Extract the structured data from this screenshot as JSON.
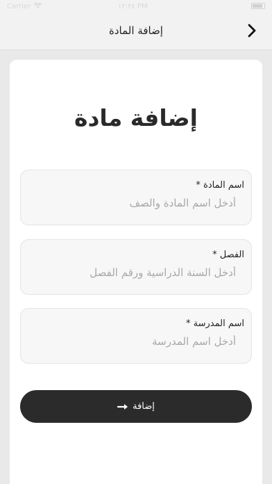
{
  "status_bar": {
    "carrier": "Carrier",
    "time": "١٢:٣٤ PM"
  },
  "nav": {
    "title": "إضافة المادة"
  },
  "form": {
    "heading": "إضافة مادة",
    "fields": [
      {
        "label": "اسم المادة *",
        "placeholder": "أدخل اسم المادة والصف"
      },
      {
        "label": "الفصل *",
        "placeholder": "أدخل السنة الدراسية ورقم الفصل"
      },
      {
        "label": "اسم المدرسة *",
        "placeholder": "أدخل اسم المدرسة"
      }
    ],
    "submit_label": "إضافة"
  },
  "icons": {
    "back": "chevron-right-icon",
    "submit": "arrow-right-icon",
    "wifi": "wifi-icon",
    "battery": "battery-icon"
  },
  "colors": {
    "background": "#e9e9e9",
    "card": "#ffffff",
    "button": "#2b2b2b",
    "field_bg": "#f7f7f7",
    "placeholder": "#a8a8a8"
  }
}
